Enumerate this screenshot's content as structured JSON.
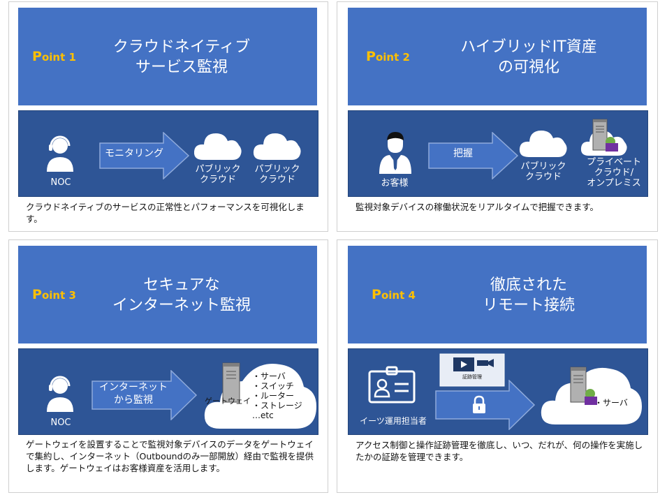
{
  "cards": [
    {
      "point_prefix": "P",
      "point_rest": "oint 1",
      "title": "クラウドネイティブ\nサービス監視",
      "arrow_label": "モニタリング",
      "source_label": "NOC",
      "cloud1_label": "パブリック\nクラウド",
      "cloud2_label": "パブリック\nクラウド",
      "description": "クラウドネイティブのサービスの正常性とパフォーマンスを可視化します。"
    },
    {
      "point_prefix": "P",
      "point_rest": "oint 2",
      "title": "ハイブリッドIT資産\nの可視化",
      "arrow_label": "把握",
      "source_label": "お客様",
      "cloud1_label": "パブリック\nクラウド",
      "cloud2_label": "プライベート\nクラウド/\nオンプレミス",
      "description": "監視対象デバイスの稼働状況をリアルタイムで把握できます。"
    },
    {
      "point_prefix": "P",
      "point_rest": "oint 3",
      "title": "セキュアな\nインターネット監視",
      "arrow_label": "インターネット\nから監視",
      "source_label": "NOC",
      "gateway_label": "ゲートウェイ",
      "list_items": "・サーバ\n・スイッチ\n・ルーター\n・ストレージ\n…etc",
      "description": "ゲートウェイを設置することで監視対象デバイスのデータをゲートウェイで集約し、インターネット（Outboundのみ一部開放）経由で監視を提供します。ゲートウェイはお客様資産を活用します。"
    },
    {
      "point_prefix": "P",
      "point_rest": "oint 4",
      "title": "徹底された\nリモート接続",
      "source_label": "イーツ運用担当者",
      "evidence_label": "証跡管理",
      "server_label": "・サーバ",
      "description": "アクセス制御と操作証跡管理を徹底し、いつ、だれが、何の操作を実施したかの証跡を管理できます。"
    }
  ],
  "colors": {
    "header_blue": "#4472c4",
    "panel_blue": "#2e5596",
    "point_yellow": "#ffc000",
    "cloud_white": "#ffffff"
  }
}
